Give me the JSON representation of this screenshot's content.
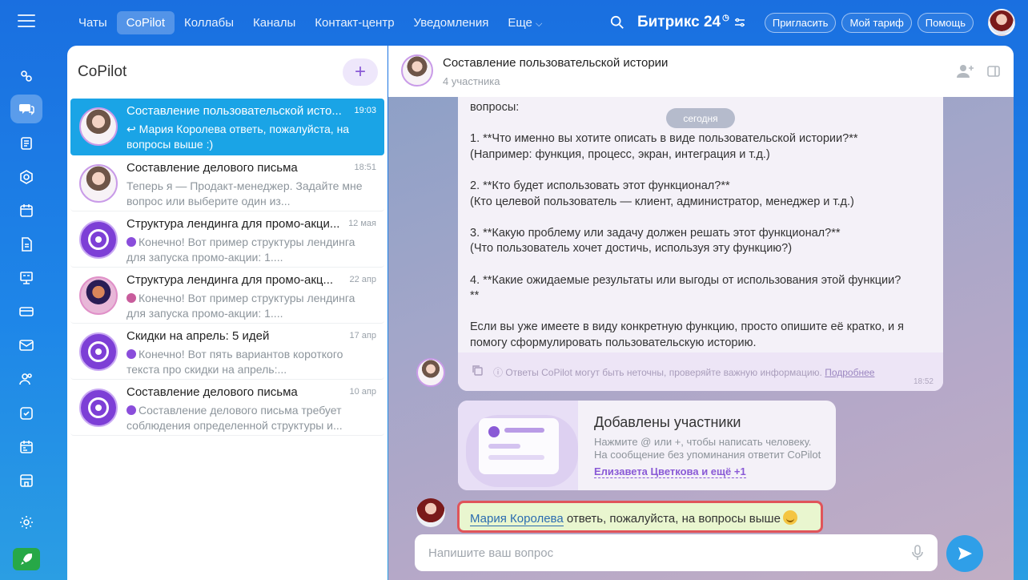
{
  "nav": {
    "items": [
      {
        "label": "Чаты",
        "active": false
      },
      {
        "label": "CoPilot",
        "active": true
      },
      {
        "label": "Коллабы",
        "active": false
      },
      {
        "label": "Каналы",
        "active": false
      },
      {
        "label": "Контакт-центр",
        "active": false
      },
      {
        "label": "Уведомления",
        "active": false
      },
      {
        "label": "Еще",
        "active": false
      }
    ],
    "more_chevron": "⌵"
  },
  "top": {
    "brand": "Битрикс",
    "brand_num": "24",
    "invite": "Пригласить",
    "tariff": "Мой тариф",
    "help": "Помощь"
  },
  "list": {
    "title": "CoPilot",
    "add_label": "+",
    "chats": [
      {
        "name": "Составление пользовательской исто...",
        "time": "19:03",
        "preview": "↩ Мария Королева ответь, пожалуйста, на вопросы выше :)",
        "avatar": "person",
        "active": true
      },
      {
        "name": "Составление делового письма",
        "time": "18:51",
        "preview": "Теперь я — Продакт-менеджер. Задайте мне вопрос или выберите один из...",
        "avatar": "person",
        "active": false
      },
      {
        "name": "Структура лендинга для промо-акци...",
        "time": "12 мая",
        "preview": "Конечно! Вот пример структуры лендинга для запуска промо-акции: 1....",
        "avatar": "copilot",
        "active": false
      },
      {
        "name": "Структура лендинга для промо-акц...",
        "time": "22 апр",
        "preview": "Конечно! Вот пример структуры лендинга для запуска промо-акции: 1....",
        "avatar": "hero",
        "active": false
      },
      {
        "name": "Скидки на апрель: 5 идей",
        "time": "17 апр",
        "preview": "Конечно! Вот пять вариантов короткого текста про скидки на апрель:...",
        "avatar": "copilot",
        "active": false
      },
      {
        "name": "Составление делового письма",
        "time": "10 апр",
        "preview": "Составление делового письма требует соблюдения определенной структуры и...",
        "avatar": "copilot",
        "active": false
      }
    ]
  },
  "chat": {
    "title": "Составление пользовательской истории",
    "participants": "4 участника",
    "date_pill": "сегодня",
    "copilot_message": "вопросы:\n\n1. **Что именно вы хотите описать в виде пользовательской истории?**\n(Например: функция, процесс, экран, интеграция и т.д.)\n\n2. **Кто будет использовать этот функционал?**\n(Кто целевой пользователь — клиент, администратор, менеджер и т.д.)\n\n3. **Какую проблему или задачу должен решать этот функционал?**\n(Что пользователь хочет достичь, используя эту функцию?)\n\n4. **Какие ожидаемые результаты или выгоды от использования этой функции?\n**\n\nЕсли вы уже имеете в виду конкретную функцию, просто опишите её кратко, и я помогу сформулировать пользовательскую историю.",
    "disclaimer": "ⓘ Ответы CoPilot могут быть неточны, проверяйте важную информацию.",
    "disclaimer_link": "Подробнее",
    "copilot_time": "18:52",
    "system_card": {
      "title": "Добавлены участники",
      "line1": "Нажмите @ или +, чтобы написать человеку.",
      "line2": "На сообщение без упоминания ответит CoPilot",
      "link": "Елизавета Цветкова и ещё +1"
    },
    "my_message": {
      "mention": "Мария Королева",
      "text": " ответь, пожалуйста, на вопросы выше"
    },
    "composer_placeholder": "Напишите ваш вопрос"
  },
  "icons": {
    "menu": "hamburger-icon",
    "search": "search-icon",
    "add_user": "add-user-icon",
    "sidebar_toggle": "panel-icon",
    "mic": "microphone-icon",
    "send": "send-icon"
  }
}
